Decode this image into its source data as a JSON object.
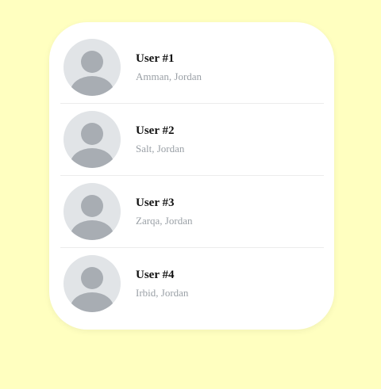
{
  "colors": {
    "page_background": "#ffffc0",
    "card_background": "#ffffff",
    "avatar_background": "#e1e4e7",
    "avatar_figure": "#a8adb3",
    "name_text": "#111111",
    "location_text": "#9aa0a6"
  },
  "users": [
    {
      "name": "User #1",
      "location": "Amman, Jordan",
      "icon": "user-silhouette-icon"
    },
    {
      "name": "User #2",
      "location": "Salt, Jordan",
      "icon": "user-silhouette-icon"
    },
    {
      "name": "User #3",
      "location": "Zarqa, Jordan",
      "icon": "user-silhouette-icon"
    },
    {
      "name": "User #4",
      "location": "Irbid, Jordan",
      "icon": "user-silhouette-icon"
    }
  ]
}
